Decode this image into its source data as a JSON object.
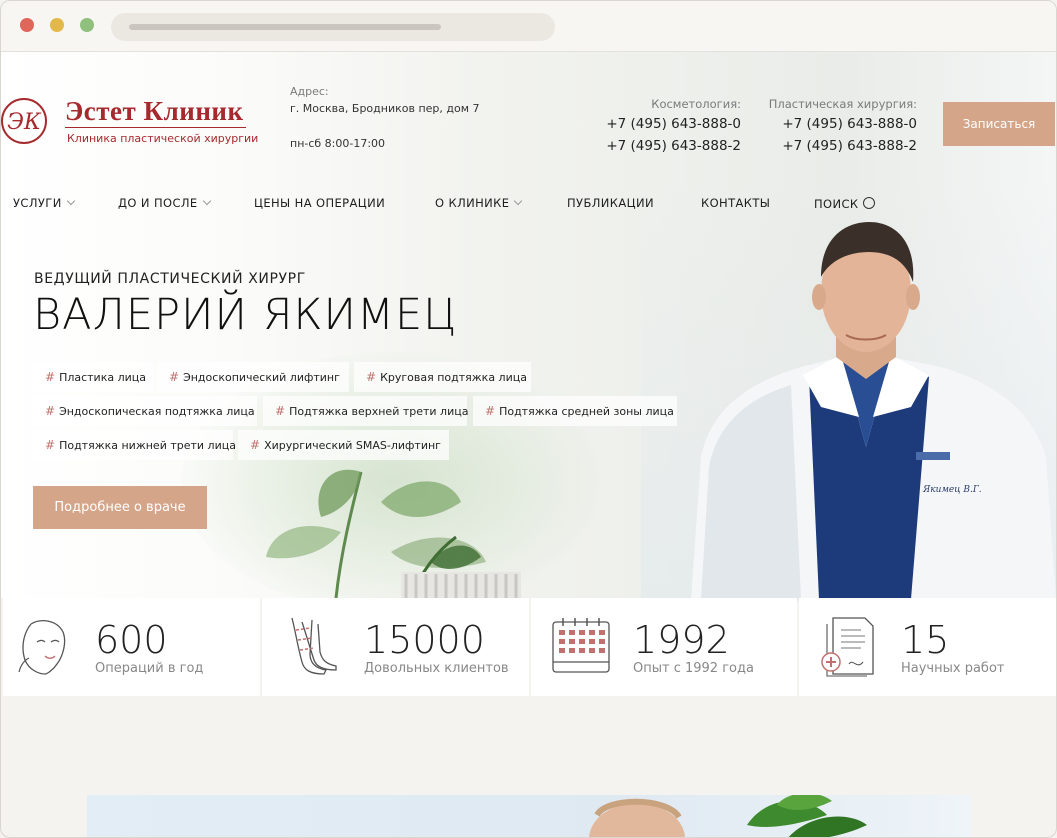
{
  "header": {
    "logo_name": "Эстет Клиник",
    "logo_sub": "Клиника пластической хирургии",
    "logo_mark": "ЭК",
    "address_label": "Адрес:",
    "address": "г. Москва, Бродников пер, дом 7",
    "hours": "пн-сб 8:00-17:00",
    "phones": {
      "cosmetology_label": "Косметология:",
      "cosmetology_1": "+7 (495) 643-888-0",
      "cosmetology_2": "+7 (495) 643-888-2",
      "surgery_label": "Пластическая хирургия:",
      "surgery_1": "+7 (495) 643-888-0",
      "surgery_2": "+7 (495) 643-888-2"
    },
    "cta": "Записаться"
  },
  "nav": {
    "items": [
      "УСЛУГИ",
      "ДО И ПОСЛЕ",
      "ЦЕНЫ НА ОПЕРАЦИИ",
      "О КЛИНИКЕ",
      "ПУБЛИКАЦИИ",
      "КОНТАКТЫ",
      "ПОИСК"
    ]
  },
  "hero": {
    "subtitle": "ВЕДУЩИЙ ПЛАСТИЧЕСКИЙ ХИРУРГ",
    "title": "ВАЛЕРИЙ ЯКИМЕЦ",
    "tags": [
      "Пластика лица",
      "Эндоскопический лифтинг",
      "Круговая подтяжка лица",
      "Эндоскопическая подтяжка лица",
      "Подтяжка верхней трети лица",
      "Подтяжка средней зоны лица",
      "Подтяжка нижней трети лица",
      "Хирургический SMAS-лифтинг"
    ],
    "tag_hash": "#",
    "button": "Подробнее о враче",
    "badge_name": "Якимец В.Г."
  },
  "stats": [
    {
      "value": "600",
      "label": "Операций в год",
      "icon": "face-icon"
    },
    {
      "value": "15000",
      "label": "Довольных клиентов",
      "icon": "legs-icon"
    },
    {
      "value": "1992",
      "label": "Опыт с 1992 года",
      "icon": "calendar-icon"
    },
    {
      "value": "15",
      "label": "Научных работ",
      "icon": "document-icon"
    }
  ],
  "colors": {
    "brand": "#a6292e",
    "accent": "#d5a58a"
  }
}
